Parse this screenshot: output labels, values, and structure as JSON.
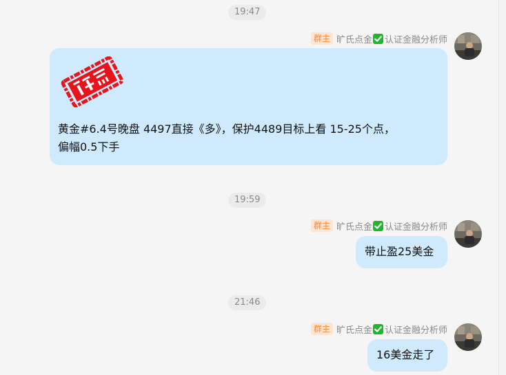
{
  "messages": [
    {
      "time": "19:47",
      "badge": "群主",
      "sender": "旷氏点金",
      "sender_suffix": "认证金融分析师",
      "sticker": "注意",
      "text_line1": "黄金#6.4号晚盘 4497直接《多》，保护4489目标上看  15-25个点，",
      "text_line2": "偏幅0.5下手"
    },
    {
      "time": "19:59",
      "badge": "群主",
      "sender": "旷氏点金",
      "sender_suffix": "认证金融分析师",
      "text": "带止盈25美金"
    },
    {
      "time": "21:46",
      "badge": "群主",
      "sender": "旷氏点金",
      "sender_suffix": "认证金融分析师",
      "text": "16美金走了"
    }
  ],
  "colors": {
    "background": "#f5f5f5",
    "bubble": "#cfeafd",
    "badge_text": "#f08a3a",
    "badge_bg": "#fde5d3",
    "verified": "#1db82a",
    "stamp": "#e8141c"
  },
  "icons": {
    "verified": "check-mark-icon",
    "avatar": "user-avatar"
  }
}
